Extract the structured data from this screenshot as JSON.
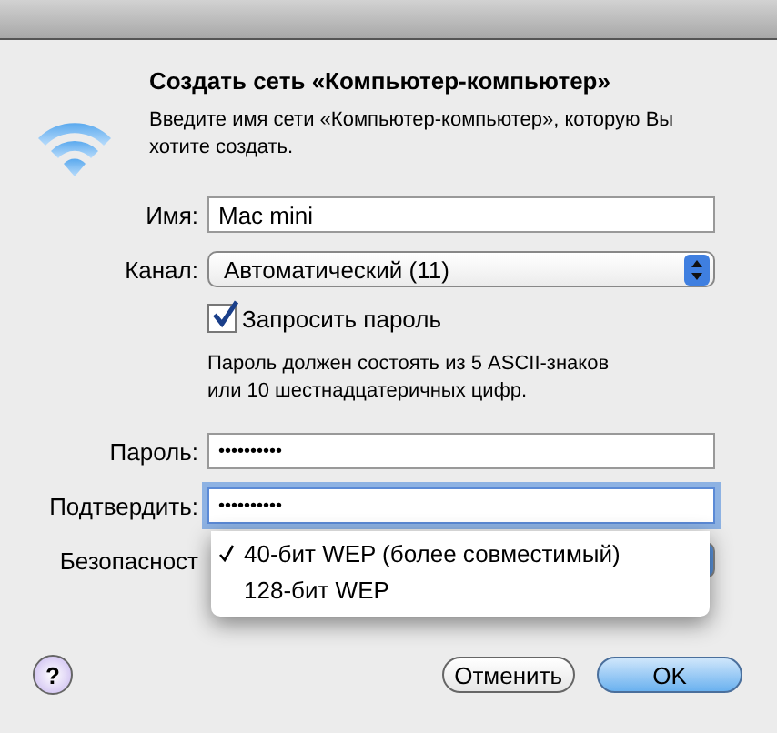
{
  "dialog": {
    "title": "Создать сеть «Компьютер-компьютер»",
    "message": "Введите имя сети «Компьютер-компьютер», которую Вы хотите создать."
  },
  "name_field": {
    "label": "Имя:",
    "value": "Mac mini"
  },
  "channel": {
    "label": "Канал:",
    "value": "Автоматический (11)"
  },
  "require_password": {
    "label": "Запросить пароль",
    "checked": true
  },
  "hint": "Пароль должен состоять из 5 ASCII-знаков или 10 шестнадцатеричных цифр.",
  "password": {
    "label": "Пароль:",
    "value": "••••••••••"
  },
  "confirm": {
    "label": "Подтвердить:",
    "value": "••••••••••",
    "focused": true
  },
  "security": {
    "label": "Безопасност",
    "menu": [
      {
        "label": "40-бит WEP (более совместимый)",
        "selected": true
      },
      {
        "label": "128-бит WEP",
        "selected": false
      }
    ]
  },
  "help_button": "?",
  "buttons": [
    {
      "label": "Отменить",
      "kind": "cancel"
    },
    {
      "label": "OK",
      "kind": "default"
    }
  ]
}
